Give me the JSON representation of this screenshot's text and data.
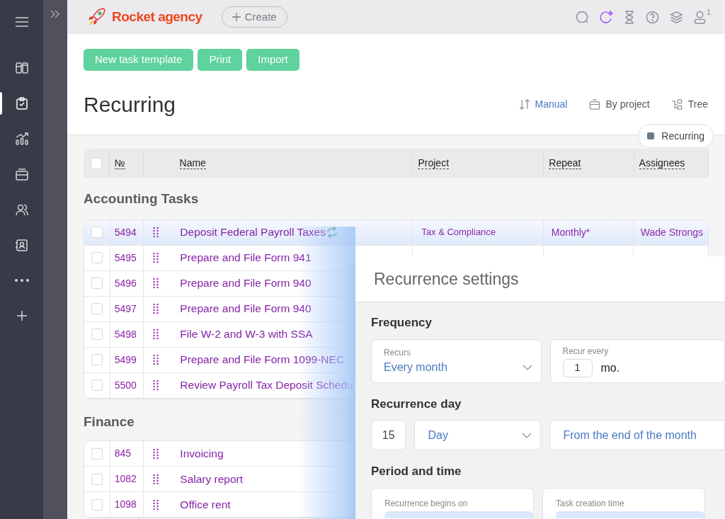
{
  "sidebar": {
    "items": [
      {
        "kind": "boards",
        "selected": false
      },
      {
        "kind": "tasks",
        "selected": true
      },
      {
        "kind": "reports",
        "selected": false
      },
      {
        "kind": "inbox",
        "selected": false
      },
      {
        "kind": "team",
        "selected": false
      },
      {
        "kind": "contacts",
        "selected": false
      },
      {
        "kind": "more",
        "selected": false
      },
      {
        "kind": "add",
        "selected": false
      }
    ]
  },
  "header": {
    "logo": "Rocket agency",
    "create_button": "Create",
    "user_badge": "1"
  },
  "toolbar": {
    "buttons": [
      "New task template",
      "Print",
      "Import"
    ]
  },
  "page_title": "Recurring",
  "view_options": [
    {
      "kind": "sort",
      "label": "Manual",
      "selected": true
    },
    {
      "kind": "group",
      "label": "By project",
      "selected": false
    },
    {
      "kind": "tree",
      "label": "Tree",
      "selected": false
    }
  ],
  "filter_chip": "Recurring",
  "table": {
    "select_all_checked": false,
    "columns": [
      "№",
      "Name",
      "Project",
      "Repeat",
      "Assignees"
    ],
    "groups": [
      {
        "title": "Accounting Tasks",
        "rows": [
          {
            "number": "5494",
            "name": "Deposit Federal Payroll Taxes",
            "selected": true,
            "checked": false,
            "recurring": true,
            "project": "Tax & Compliance",
            "repeat": "Monthly*",
            "assignees": "Wade Strongs"
          },
          {
            "number": "5495",
            "name": "Prepare and File Form 941",
            "selected": false,
            "checked": false
          },
          {
            "number": "5496",
            "name": "Prepare and File Form 940",
            "selected": false,
            "checked": false
          },
          {
            "number": "5497",
            "name": "Prepare and File Form 940",
            "selected": false,
            "checked": false
          },
          {
            "number": "5498",
            "name": "File W-2 and W-3 with SSA",
            "selected": false,
            "checked": false
          },
          {
            "number": "5499",
            "name": "Prepare and File Form 1099-NEC",
            "selected": false,
            "checked": false
          },
          {
            "number": "5500",
            "name": "Review Payroll Tax Deposit Schedu",
            "selected": false,
            "checked": false
          }
        ]
      },
      {
        "title": "Finance",
        "rows": [
          {
            "number": "845",
            "name": "Invoicing",
            "selected": false,
            "checked": false
          },
          {
            "number": "1082",
            "name": "Salary report",
            "selected": false,
            "checked": false
          },
          {
            "number": "1098",
            "name": "Office rent",
            "selected": false,
            "checked": false
          }
        ]
      }
    ]
  },
  "modal": {
    "title": "Recurrence settings",
    "sections": [
      {
        "title": "Frequency",
        "fields": [
          {
            "kind": "select",
            "label": "Recurs",
            "value": "Every month"
          },
          {
            "kind": "number",
            "label": "Recur every",
            "value": "1",
            "unit": "mo."
          }
        ]
      },
      {
        "title": "Recurrence day",
        "fields": [
          {
            "kind": "input",
            "value": "15"
          },
          {
            "kind": "dropdown",
            "value": "Day"
          },
          {
            "kind": "option",
            "value": "From the end of the month"
          }
        ]
      },
      {
        "title": "Period and time",
        "fields": [
          {
            "kind": "date",
            "label": "Recurrence begins on"
          },
          {
            "kind": "time",
            "label": "Task creation time"
          }
        ]
      }
    ]
  }
}
